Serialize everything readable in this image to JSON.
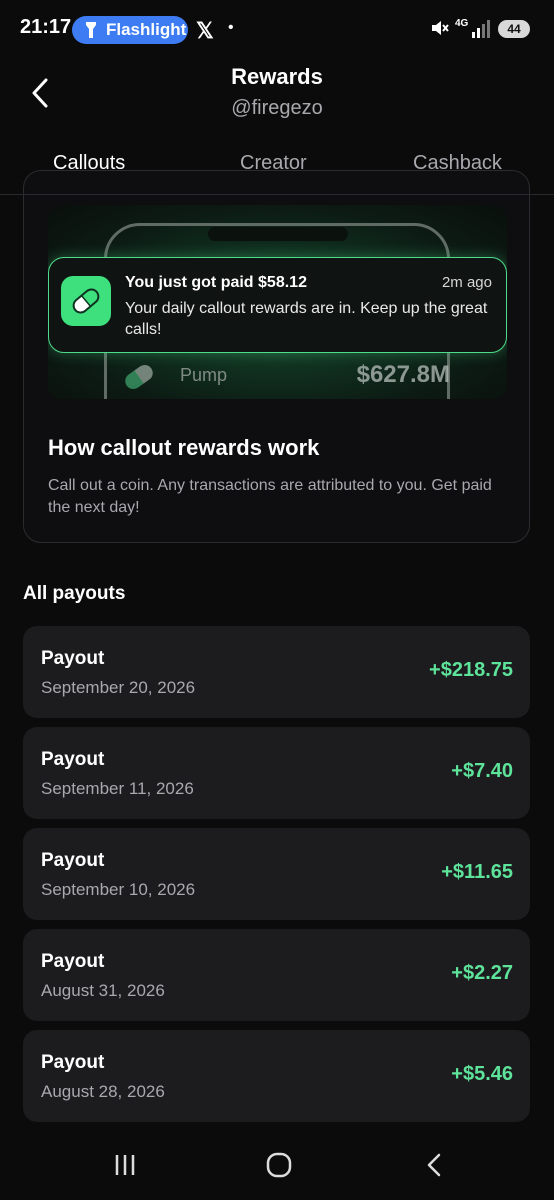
{
  "status_bar": {
    "time": "21:17",
    "flashlight_label": "Flashlight",
    "x_label": "𝕏",
    "dot": "•",
    "network": "4G",
    "battery": "44"
  },
  "header": {
    "title": "Rewards",
    "subtitle": "@firegezo"
  },
  "tabs": [
    {
      "label": "Callouts",
      "active": true
    },
    {
      "label": "Creator",
      "active": false
    },
    {
      "label": "Cashback",
      "active": false
    }
  ],
  "callout_card": {
    "promo": {
      "notification_title": "You just got paid $58.12",
      "notification_time": "2m ago",
      "notification_body": "Your daily callout rewards are in. Keep up the great calls!",
      "pump_label": "Pump",
      "pump_value": "$627.8M"
    },
    "heading": "How callout rewards work",
    "description": "Call out a coin. Any transactions are attributed to you. Get paid the next day!"
  },
  "payouts": {
    "title": "All payouts",
    "items": [
      {
        "label": "Payout",
        "date": "September 20, 2026",
        "amount": "+$218.75"
      },
      {
        "label": "Payout",
        "date": "September 11, 2026",
        "amount": "+$7.40"
      },
      {
        "label": "Payout",
        "date": "September 10, 2026",
        "amount": "+$11.65"
      },
      {
        "label": "Payout",
        "date": "August 31, 2026",
        "amount": "+$2.27"
      },
      {
        "label": "Payout",
        "date": "August 28, 2026",
        "amount": "+$5.46"
      }
    ]
  },
  "colors": {
    "accent_green": "#5ee39a",
    "background": "#0b0b0c",
    "card": "#1c1c1f",
    "flashlight_pill": "#3e7cf4"
  }
}
